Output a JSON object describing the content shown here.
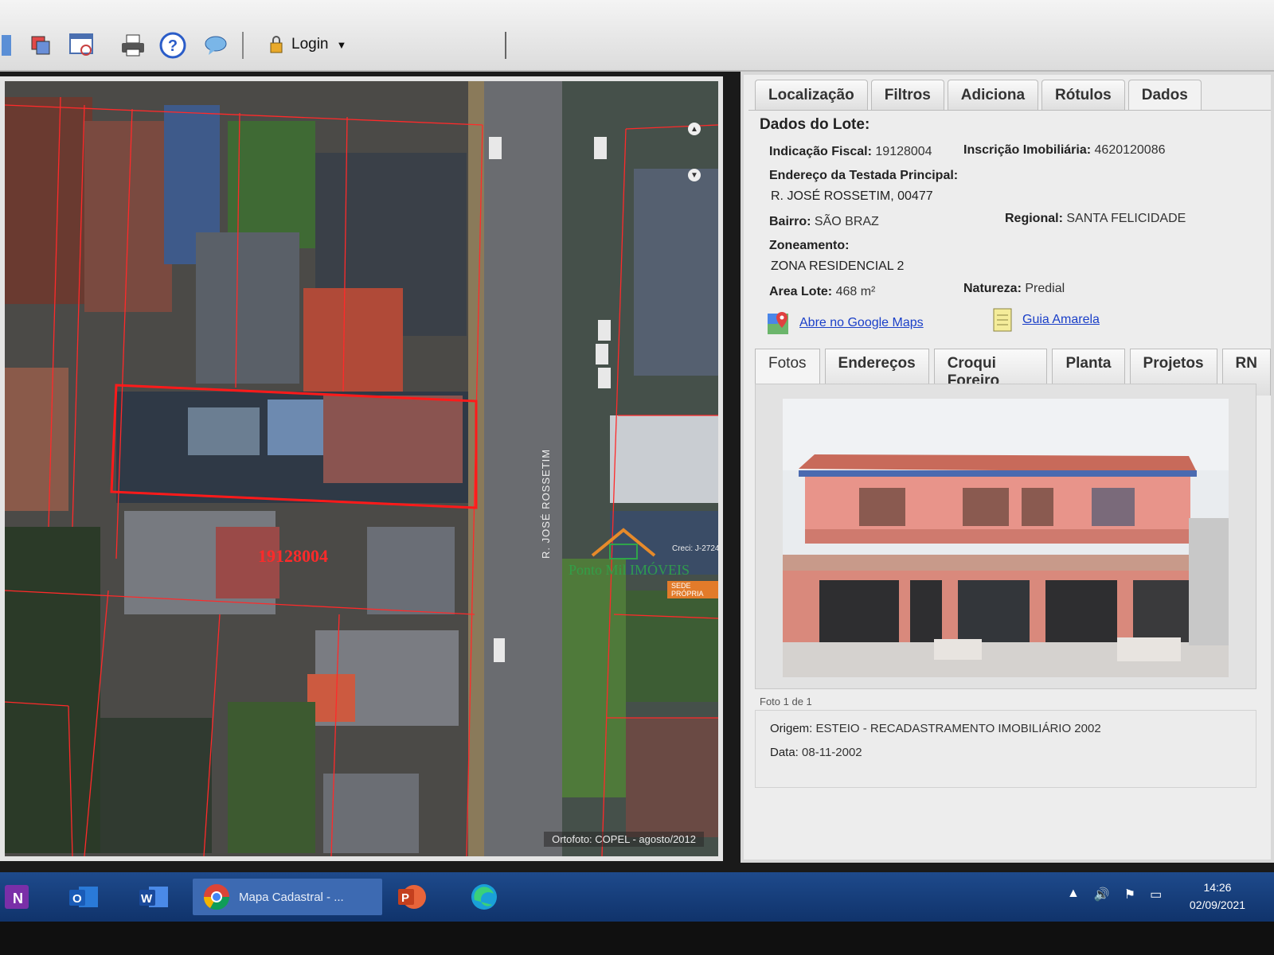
{
  "toolbar": {
    "login_label": "Login",
    "icons": [
      "layers-icon",
      "window-search-icon",
      "print-icon",
      "help-icon",
      "chat-icon",
      "lock-icon"
    ]
  },
  "map": {
    "parcel_id": "19128004",
    "street": "R. JOSÉ ROSSETIM",
    "credit": "Ortofoto: COPEL - agosto/2012",
    "watermark": {
      "name": "Ponto Mil IMÓVEIS",
      "creci": "Creci: J-2724",
      "sede": "SEDE PRÓPRIA"
    }
  },
  "panel": {
    "tabs": [
      "Localização",
      "Filtros",
      "Adiciona",
      "Rótulos",
      "Dados"
    ],
    "active_tab": "Dados",
    "section_title": "Dados do Lote:",
    "indicacao_label": "Indicação Fiscal:",
    "indicacao_value": "19128004",
    "inscricao_label": "Inscrição Imobiliária:",
    "inscricao_value": "4620120086",
    "endereco_label": "Endereço da Testada Principal:",
    "endereco_value": "R. JOSÉ ROSSETIM, 00477",
    "bairro_label": "Bairro:",
    "bairro_value": "SÃO BRAZ",
    "regional_label": "Regional:",
    "regional_value": "SANTA FELICIDADE",
    "zoneamento_label": "Zoneamento:",
    "zoneamento_value": "ZONA RESIDENCIAL 2",
    "area_label": "Area Lote:",
    "area_value": "468 m²",
    "natureza_label": "Natureza:",
    "natureza_value": "Predial",
    "google_maps_link": "Abre no Google Maps",
    "guia_link": "Guia Amarela",
    "subtabs": [
      "Fotos",
      "Endereços",
      "Croqui Foreiro",
      "Planta",
      "Projetos",
      "RN"
    ],
    "active_subtab": "Fotos",
    "photo_caption": "Foto 1 de 1",
    "origem_label": "Origem:",
    "origem_value": "ESTEIO - RECADASTRAMENTO IMOBILIÁRIO 2002",
    "data_label": "Data:",
    "data_value": "08-11-2002"
  },
  "taskbar": {
    "chrome_title": "Mapa Cadastral - ...",
    "time": "14:26",
    "date": "02/09/2021"
  },
  "colors": {
    "accent_red": "#ff2a2a",
    "link_blue": "#1a3fc8",
    "taskbar": "#16407e"
  }
}
